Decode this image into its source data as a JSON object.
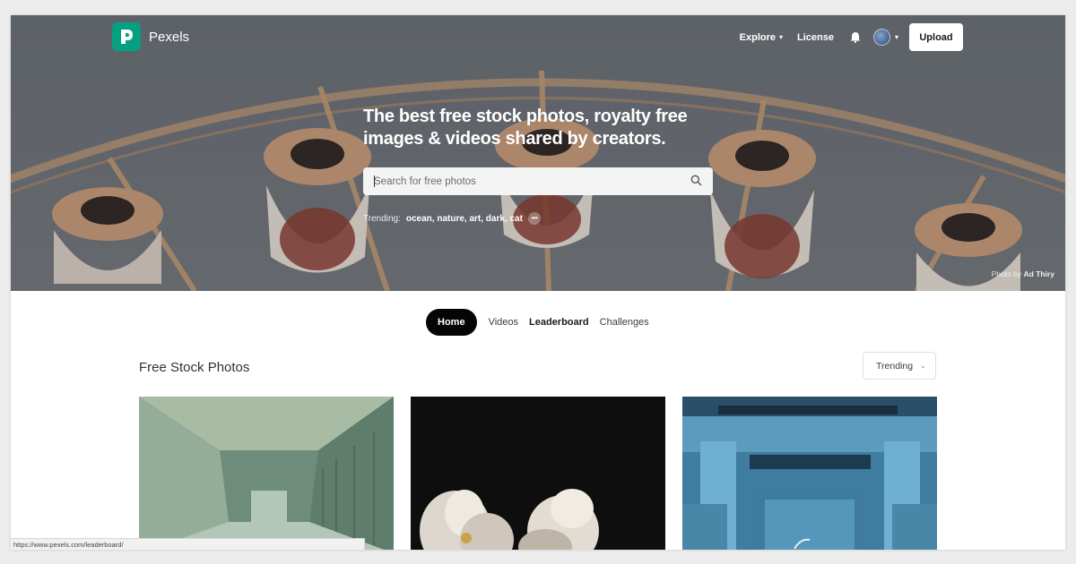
{
  "nav": {
    "brand": "Pexels",
    "explore_label": "Explore",
    "license_label": "License",
    "upload_label": "Upload"
  },
  "hero": {
    "headline": "The best free stock photos, royalty free images & videos shared by creators.",
    "search_placeholder": "Search for free photos",
    "trending_label": "Trending:",
    "trending_terms": "ocean, nature, art, dark, cat",
    "credit_prefix": "Photo by",
    "credit_author": "Ad Thiry"
  },
  "tabs": [
    {
      "label": "Home",
      "active": true
    },
    {
      "label": "Videos",
      "active": false
    },
    {
      "label": "Leaderboard",
      "active": false
    },
    {
      "label": "Challenges",
      "active": false
    }
  ],
  "section": {
    "title": "Free Stock Photos",
    "sort_label": "Trending"
  },
  "status_bar": {
    "url": "https://www.pexels.com/leaderboard/"
  },
  "colors": {
    "brand": "#05a081",
    "active_tab": "#050505"
  },
  "icons": {
    "logo": "pexels-logo-icon",
    "bell": "bell-icon",
    "search": "search-icon",
    "chevron": "chevron-down-icon",
    "more": "more-dots-icon"
  }
}
